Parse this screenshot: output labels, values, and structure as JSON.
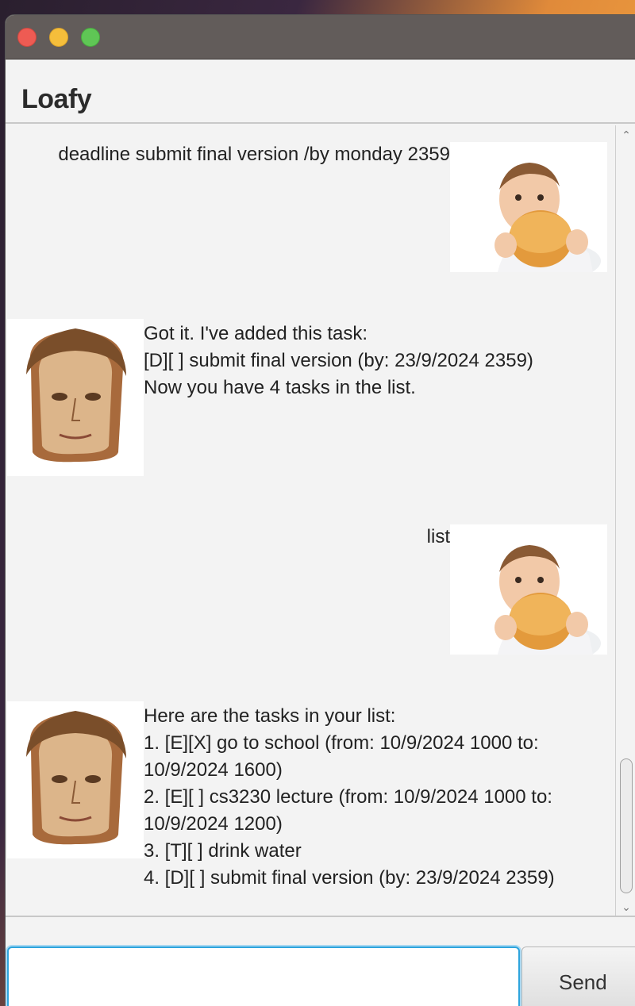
{
  "app": {
    "title": "Loafy"
  },
  "messages": [
    {
      "sender": "user",
      "text": "deadline submit final version /by monday 2359",
      "avatar": "baby-eating-bun-avatar"
    },
    {
      "sender": "bot",
      "lines": [
        "Got it. I've added this task:",
        "[D][ ] submit final version (by: 23/9/2024 2359)",
        "Now you have 4 tasks in the list."
      ],
      "avatar": "bread-face-avatar"
    },
    {
      "sender": "user",
      "text": "list",
      "avatar": "baby-eating-bun-avatar"
    },
    {
      "sender": "bot",
      "lines": [
        "Here are the tasks in your list:",
        "1. [E][X] go to school (from: 10/9/2024 1000 to:",
        "10/9/2024 1600)",
        "2. [E][ ] cs3230 lecture (from: 10/9/2024 1000 to:",
        "10/9/2024 1200)",
        "3. [T][ ] drink water",
        "4. [D][ ] submit final version (by: 23/9/2024 2359)"
      ],
      "avatar": "bread-face-avatar"
    }
  ],
  "input": {
    "value": "",
    "placeholder": ""
  },
  "send_button": {
    "label": "Send"
  },
  "colors": {
    "titlebar": "#625c5a",
    "close": "#ee5b53",
    "minimize": "#f5be3b",
    "maximize": "#5fc655",
    "input_focus": "#2ea4dd",
    "background": "#f3f3f3"
  }
}
